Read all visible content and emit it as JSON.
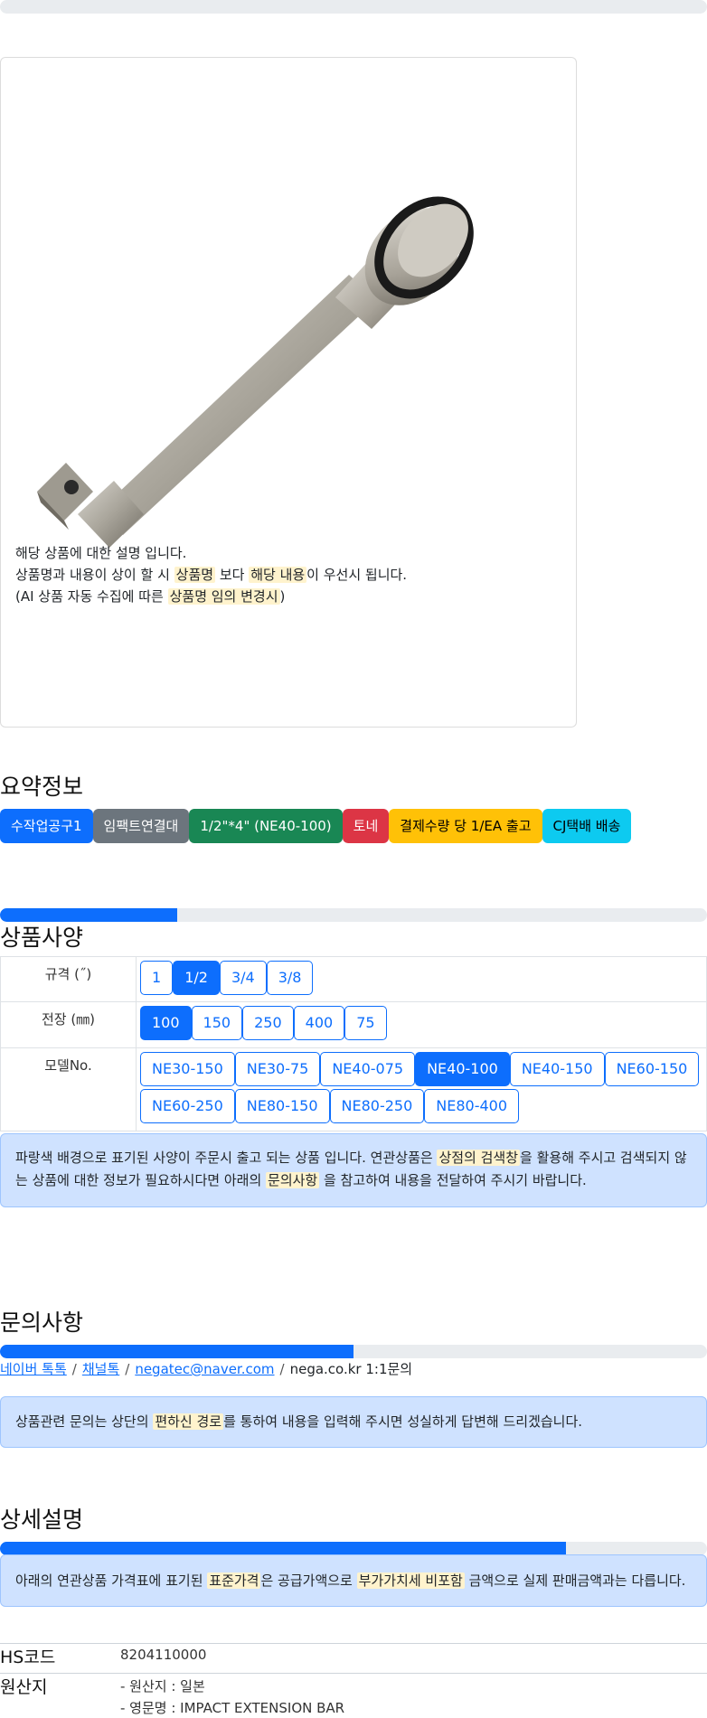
{
  "intro": {
    "line1": "해당 상품에 대한 설명 입니다.",
    "line2": {
      "pre": "상품명과 내용이 상이 할 시 ",
      "hl1": "상품명",
      "mid": " 보다 ",
      "hl2": "해당 내용",
      "post": "이 우선시 됩니다."
    },
    "line3": {
      "pre": "(AI 상품 자동 수집에 따른 ",
      "hl": "상품명 임의 변경시",
      "post": ")"
    }
  },
  "summary": {
    "title": "요약정보",
    "badges": [
      {
        "label": "수작업공구1",
        "bg": "#0d6efd",
        "fg": "#ffffff"
      },
      {
        "label": "임팩트연결대",
        "bg": "#6c757d",
        "fg": "#ffffff"
      },
      {
        "label": "1/2\"*4\" (NE40-100)",
        "bg": "#198754",
        "fg": "#ffffff"
      },
      {
        "label": "토네",
        "bg": "#dc3545",
        "fg": "#ffffff"
      },
      {
        "label": "결제수량 당 1/EA 출고",
        "bg": "#ffc107",
        "fg": "#000000"
      },
      {
        "label": "CJ택배 배송",
        "bg": "#0dcaf0",
        "fg": "#000000"
      }
    ]
  },
  "spec": {
    "title": "상품사양",
    "progress": 0.25,
    "rows": [
      {
        "label": "규격 (˝)",
        "options": [
          "1",
          "1/2",
          "3/4",
          "3/8"
        ],
        "selected": "1/2"
      },
      {
        "label": "전장 (㎜)",
        "options": [
          "100",
          "150",
          "250",
          "400",
          "75"
        ],
        "selected": "100"
      },
      {
        "label": "모델No.",
        "options": [
          "NE30-150",
          "NE30-75",
          "NE40-075",
          "NE40-100",
          "NE40-150",
          "NE60-150",
          "NE60-250",
          "NE80-150",
          "NE80-250",
          "NE80-400"
        ],
        "selected": "NE40-100"
      }
    ],
    "notice": {
      "pre": "파랑색 배경으로 표기된 사양이 주문시 출고 되는 상품 입니다. 연관상품은 ",
      "hl1": "상점의 검색창",
      "mid1": "을 활용해 주시고 검색되지 않",
      "line2_pre": "는 상품에 대한 정보가 필요하시다면 아래의 ",
      "hl2": "문의사항",
      "post": " 을 참고하여 내용을 전달하여 주시기 바랍니다."
    }
  },
  "inquiry": {
    "title": "문의사항",
    "progress": 0.5,
    "links": [
      "네이버 톡톡",
      "채널톡",
      "negatec@naver.com"
    ],
    "plain": "nega.co.kr 1:1문의",
    "separator": "/",
    "notice": {
      "pre": "상품관련 문의는 상단의 ",
      "hl": "편하신 경로",
      "post": "를 통하여 내용을 입력해 주시면 성실하게 답변해 드리겠습니다."
    }
  },
  "detail": {
    "title": "상세설명",
    "progress": 0.8,
    "notice": {
      "pre": "아래의 연관상품 가격표에 표기된 ",
      "hl1": "표준가격",
      "mid": "은 공급가액으로 ",
      "hl2": "부가가치세 비포함",
      "post": " 금액으로 실제 판매금액과는 다릅니다."
    },
    "hs_label": "HS코드",
    "hs_value": "8204110000",
    "origin_label": "원산지",
    "origin_lines": [
      "- 원산지 : 일본",
      "- 영문명 : IMPACT EXTENSION BAR"
    ]
  }
}
